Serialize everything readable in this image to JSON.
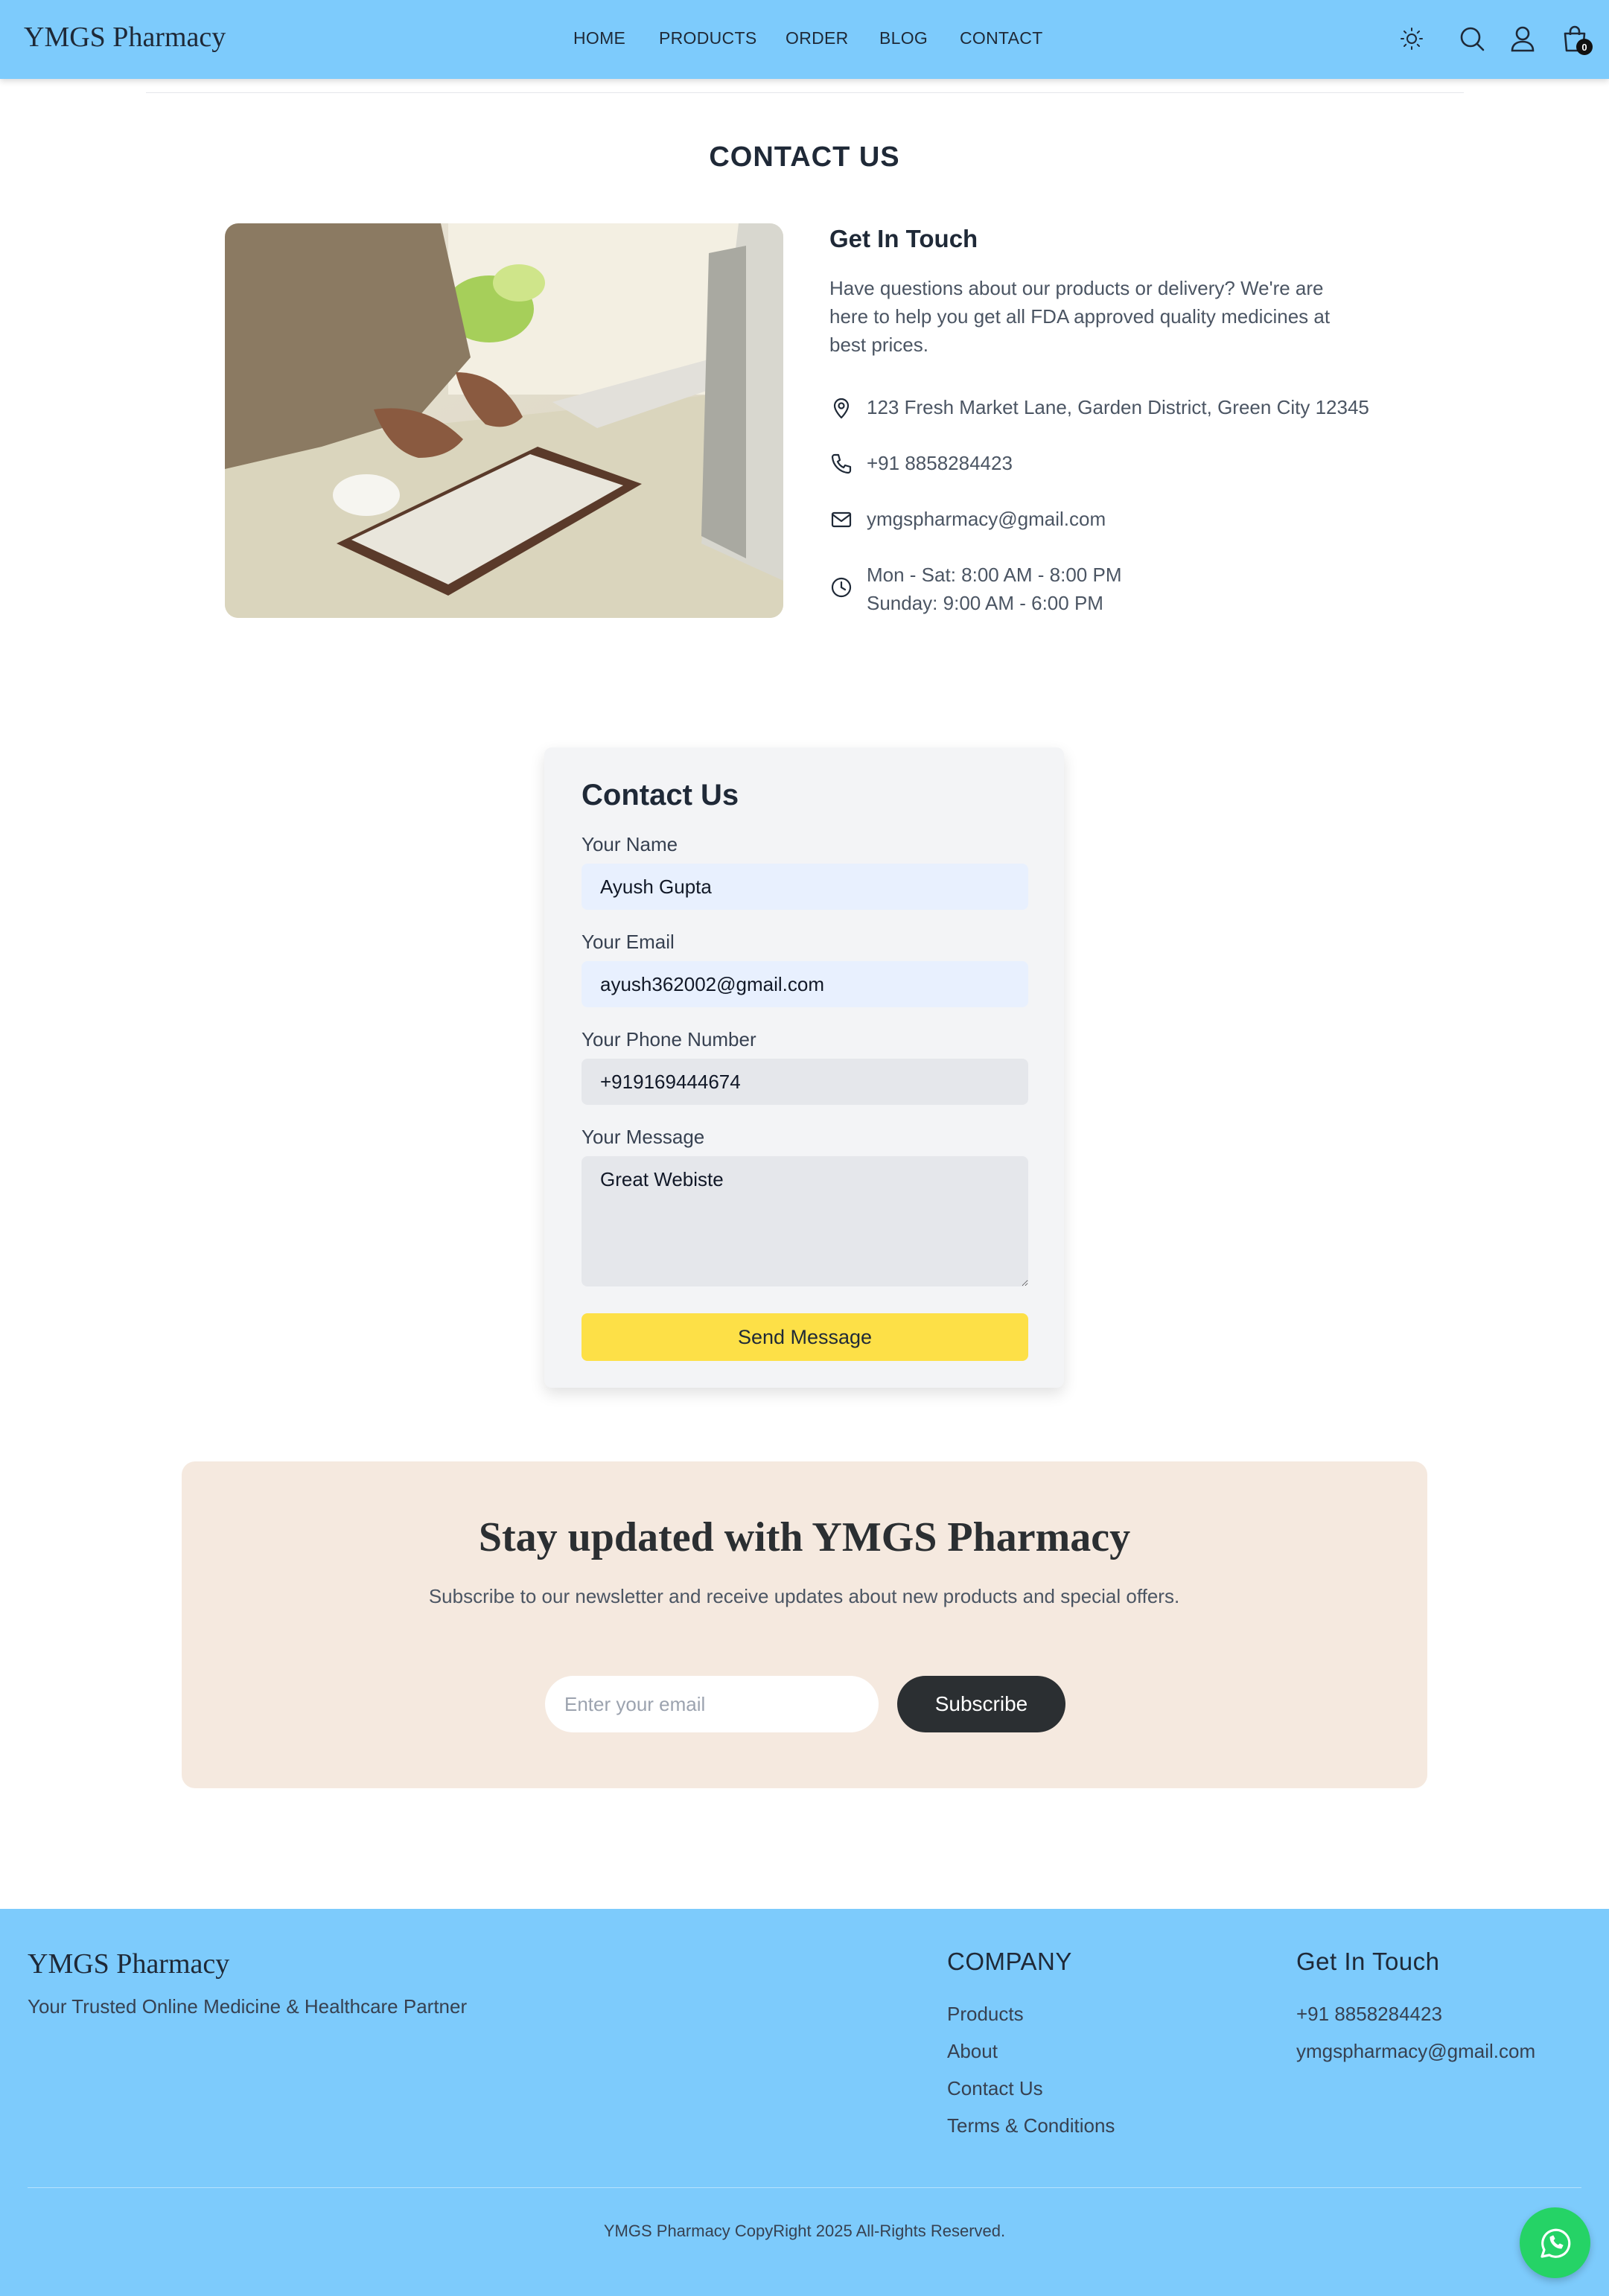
{
  "header": {
    "brand": "YMGS Pharmacy",
    "nav": [
      "HOME",
      "PRODUCTS",
      "ORDER",
      "BLOG",
      "CONTACT"
    ],
    "icons": [
      "sun-icon",
      "search-icon",
      "user-icon",
      "shopping-bag-icon"
    ],
    "cart_count": "0"
  },
  "contact": {
    "page_title": "CONTACT US",
    "get_in_touch_title": "Get In Touch",
    "description": "Have questions about our products or delivery? We're are here to help you get all FDA approved quality medicines at best prices.",
    "address": "123 Fresh Market Lane, Garden District, Green City 12345",
    "phone": "+91 8858284423",
    "email": "ymgspharmacy@gmail.com",
    "hours_weekday": "Mon - Sat: 8:00 AM - 8:00 PM",
    "hours_sunday": "Sunday: 9:00 AM - 6:00 PM"
  },
  "form": {
    "title": "Contact Us",
    "name_label": "Your Name",
    "name_value": "Ayush Gupta",
    "email_label": "Your Email",
    "email_value": "ayush362002@gmail.com",
    "phone_label": "Your Phone Number",
    "phone_value": "+919169444674",
    "message_label": "Your Message",
    "message_value": "Great Webiste",
    "submit_label": "Send Message"
  },
  "newsletter": {
    "title": "Stay updated with YMGS Pharmacy",
    "description": "Subscribe to our newsletter and receive updates about new products and special offers.",
    "email_placeholder": "Enter your email",
    "button_label": "Subscribe"
  },
  "footer": {
    "brand": "YMGS Pharmacy",
    "tagline": "Your Trusted Online Medicine & Healthcare Partner",
    "company_heading": "COMPANY",
    "company_links": [
      "Products",
      "About",
      "Contact Us",
      "Terms & Conditions"
    ],
    "contact_heading": "Get In Touch",
    "phone": "+91 8858284423",
    "email": "ymgspharmacy@gmail.com",
    "copyright": "YMGS Pharmacy CopyRight 2025 All-Rights Reserved."
  },
  "colors": {
    "header_bg": "#7dcbfc",
    "footer_bg": "#7dcbfc",
    "send_button": "#fde047",
    "newsletter_bg": "#f5e9df",
    "subscribe_button": "#2b2f32",
    "whatsapp": "#25d366"
  }
}
